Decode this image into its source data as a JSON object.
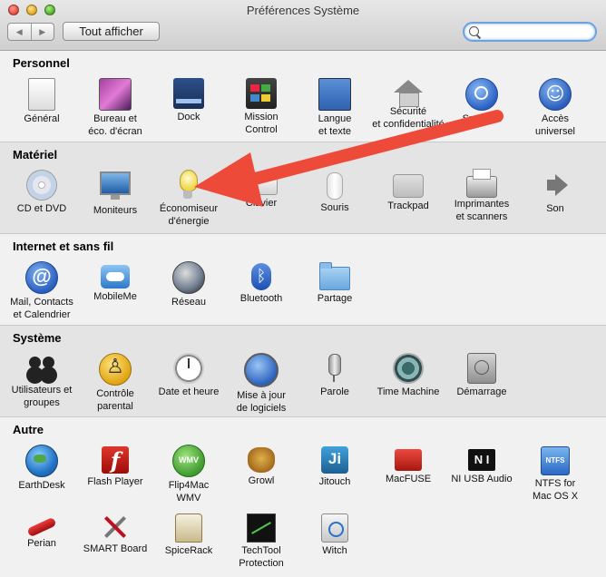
{
  "window": {
    "title": "Préférences Système"
  },
  "toolbar": {
    "back_glyph": "◀",
    "forward_glyph": "▶",
    "show_all_label": "Tout afficher",
    "search_value": "",
    "search_placeholder": ""
  },
  "sections": [
    {
      "title": "Personnel",
      "items": [
        {
          "label1": "Général",
          "label2": "",
          "icon": "general-icon"
        },
        {
          "label1": "Bureau et",
          "label2": "éco. d'écran",
          "icon": "desktop-screensaver-icon"
        },
        {
          "label1": "Dock",
          "label2": "",
          "icon": "dock-icon"
        },
        {
          "label1": "Mission",
          "label2": "Control",
          "icon": "mission-control-icon"
        },
        {
          "label1": "Langue",
          "label2": "et texte",
          "icon": "language-flag-icon"
        },
        {
          "label1": "Sécurité",
          "label2": "et confidentialité",
          "icon": "security-house-icon"
        },
        {
          "label1": "Spotlight",
          "label2": "",
          "icon": "spotlight-icon"
        },
        {
          "label1": "Accès",
          "label2": "universel",
          "icon": "accessibility-icon"
        }
      ]
    },
    {
      "title": "Matériel",
      "items": [
        {
          "label1": "CD et DVD",
          "label2": "",
          "icon": "cd-dvd-icon"
        },
        {
          "label1": "Moniteurs",
          "label2": "",
          "icon": "monitor-icon"
        },
        {
          "label1": "Économiseur",
          "label2": "d'énergie",
          "icon": "energy-bulb-icon"
        },
        {
          "label1": "Clavier",
          "label2": "",
          "icon": "keyboard-icon"
        },
        {
          "label1": "Souris",
          "label2": "",
          "icon": "mouse-icon"
        },
        {
          "label1": "Trackpad",
          "label2": "",
          "icon": "trackpad-icon"
        },
        {
          "label1": "Imprimantes",
          "label2": "et scanners",
          "icon": "printer-icon"
        },
        {
          "label1": "Son",
          "label2": "",
          "icon": "speaker-icon"
        }
      ]
    },
    {
      "title": "Internet et sans fil",
      "items": [
        {
          "label1": "Mail, Contacts",
          "label2": "et Calendrier",
          "icon": "mail-at-icon"
        },
        {
          "label1": "MobileMe",
          "label2": "",
          "icon": "mobileme-cloud-icon"
        },
        {
          "label1": "Réseau",
          "label2": "",
          "icon": "network-globe-icon"
        },
        {
          "label1": "Bluetooth",
          "label2": "",
          "icon": "bluetooth-icon"
        },
        {
          "label1": "Partage",
          "label2": "",
          "icon": "sharing-folder-icon"
        }
      ]
    },
    {
      "title": "Système",
      "items": [
        {
          "label1": "Utilisateurs et",
          "label2": "groupes",
          "icon": "users-icon"
        },
        {
          "label1": "Contrôle",
          "label2": "parental",
          "icon": "parental-controls-icon"
        },
        {
          "label1": "Date et heure",
          "label2": "",
          "icon": "clock-icon"
        },
        {
          "label1": "Mise à jour",
          "label2": "de logiciels",
          "icon": "software-update-icon"
        },
        {
          "label1": "Parole",
          "label2": "",
          "icon": "microphone-icon"
        },
        {
          "label1": "Time Machine",
          "label2": "",
          "icon": "time-machine-icon"
        },
        {
          "label1": "Démarrage",
          "label2": "",
          "icon": "startup-disk-icon"
        }
      ]
    },
    {
      "title": "Autre",
      "items": [
        {
          "label1": "EarthDesk",
          "label2": "",
          "icon": "earthdesk-icon"
        },
        {
          "label1": "Flash Player",
          "label2": "",
          "icon": "flash-player-icon"
        },
        {
          "label1": "Flip4Mac",
          "label2": "WMV",
          "icon": "flip4mac-wmv-icon"
        },
        {
          "label1": "Growl",
          "label2": "",
          "icon": "growl-icon"
        },
        {
          "label1": "Jitouch",
          "label2": "",
          "icon": "jitouch-icon"
        },
        {
          "label1": "MacFUSE",
          "label2": "",
          "icon": "macfuse-icon"
        },
        {
          "label1": "NI USB Audio",
          "label2": "",
          "icon": "ni-usb-audio-icon"
        },
        {
          "label1": "NTFS for",
          "label2": "Mac OS X",
          "icon": "ntfs-icon"
        },
        {
          "label1": "Perian",
          "label2": "",
          "icon": "perian-icon"
        },
        {
          "label1": "SMART Board",
          "label2": "",
          "icon": "smart-board-tools-icon"
        },
        {
          "label1": "SpiceRack",
          "label2": "",
          "icon": "spicerack-icon"
        },
        {
          "label1": "TechTool",
          "label2": "Protection",
          "icon": "techtool-icon"
        },
        {
          "label1": "Witch",
          "label2": "",
          "icon": "witch-icon"
        }
      ]
    }
  ],
  "annotation": {
    "color": "#ee4a3a"
  }
}
